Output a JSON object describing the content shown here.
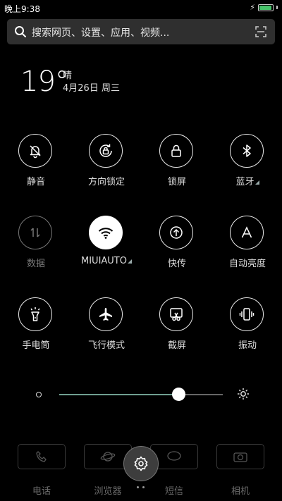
{
  "status_bar": {
    "time": "晚上9:38",
    "battery_percent": 95
  },
  "search": {
    "placeholder": "搜索网页、设置、应用、视频..."
  },
  "weather": {
    "temperature": "19°",
    "condition": "晴",
    "date": "4月26日 周三"
  },
  "toggles": [
    {
      "label": "静音",
      "icon": "bell-off-icon",
      "state": "off"
    },
    {
      "label": "方向锁定",
      "icon": "rotation-lock-icon",
      "state": "off"
    },
    {
      "label": "锁屏",
      "icon": "lock-icon",
      "state": "off"
    },
    {
      "label": "蓝牙",
      "icon": "bluetooth-icon",
      "state": "off",
      "has_submenu": true
    },
    {
      "label": "数据",
      "icon": "data-arrows-icon",
      "state": "disabled"
    },
    {
      "label": "MIUIAUTO",
      "icon": "wifi-icon",
      "state": "on",
      "has_submenu": true
    },
    {
      "label": "快传",
      "icon": "quick-transfer-icon",
      "state": "off"
    },
    {
      "label": "自动亮度",
      "icon": "auto-brightness-icon",
      "state": "off"
    },
    {
      "label": "手电筒",
      "icon": "flashlight-icon",
      "state": "off"
    },
    {
      "label": "飞行模式",
      "icon": "airplane-icon",
      "state": "off"
    },
    {
      "label": "截屏",
      "icon": "screenshot-icon",
      "state": "off"
    },
    {
      "label": "振动",
      "icon": "vibrate-icon",
      "state": "off"
    }
  ],
  "brightness": {
    "level": 0.73
  },
  "dock": [
    {
      "label": "电话",
      "icon": "phone-icon"
    },
    {
      "label": "浏览器",
      "icon": "browser-icon"
    },
    {
      "label": "短信",
      "icon": "message-icon"
    },
    {
      "label": "相机",
      "icon": "camera-icon"
    }
  ],
  "colors": {
    "background": "#000000",
    "toggle_on": "#ffffff",
    "accent": "#6f9f90",
    "battery": "#47c46a"
  }
}
